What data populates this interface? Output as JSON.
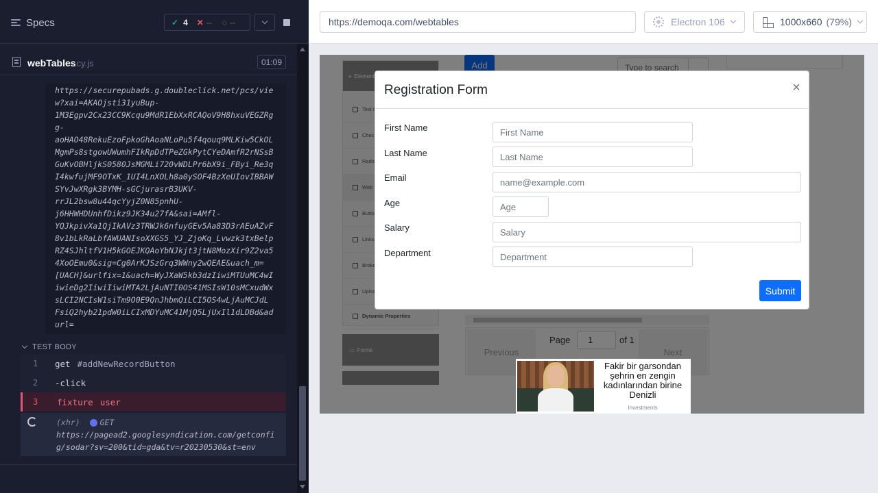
{
  "runner": {
    "specs_label": "Specs",
    "stats": {
      "passed": "4",
      "failed": "--",
      "pending": "--"
    },
    "spec": {
      "name": "webTables",
      "ext": ".cy.js",
      "duration": "01:09"
    },
    "log_url": "https://securepubads.g.doubleclick.net/pcs/view?xai=AKAOjsti31yuBup-1M3Egpv2Cx23CC9Kcqu9MdR1EbXxRCAQoV9H8hxuVEGZRgg-aoHAO48RekuEzoFpkoGhAoaNLoPu5f4qouq9MLKiw5CkOLMgmPs8stgowUWumhFIkRpDdTPeZGkPytCYeDAmfR2rNSsBGuKvOBHljkS0580JsMGMLi720vWDLPr6bX9i_FByi_Re3qI4kwfujMF9OTxK_1UI4LnXOLh8a0ySOF4BzXeUIovIBBAWSYvJwXRgk3BYMH-sGCjurasrB3UKV-rrJL2bsw8u44qcYyjZ0N85pnhU-j6HHWHDUnhfDikz9JK34u27fA&sai=AMfl-YQJkpivXa1QjIkAVz3TRWJk6nfuyGEv5Aa83D3rAEuAZvF8v1bLkRaLbfAWUANIsoXXGS5_YJ_ZjoKq_Lvwzk3txBelpRZ4SJhltfV1H5kGOEJKQAoYbNJkjt3jtN8MozXir9Z2va54XoOEmu0&sig=Cg0ArKJSzGrq3WWny2wQEAE&uach_m=[UACH]&urlfix=1&uach=WyJXaW5kb3dzIiwiMTUuMC4wIiwieDg2IiwiIiwiMTA2LjAuNTI0OS41MSIsW10sMCxudWxsLCI2NCIsW1siTm9O0E9QnJhbmQiLCI5OS4wLjAuMCJdLFsiQ2hyb21pdW0iLCIxMDYuMC41MjQ5LjUxIl1dLDBd&adurl=",
    "log_lines": [
      "https://securepubads.g.doubleclick.net/pcs/vie",
      "w?xai=AKAOjsti31yuBup-",
      "1M3Egpv2Cx23CC9Kcqu9MdR1EbXxRCAQoV9H8hxuVEGZRg",
      "g-",
      "aoHAO48RekuEzoFpkoGhAoaNLoPu5f4qouq9MLKiw5CkOL",
      "MgmPs8stgowUWumhFIkRpDdTPeZGkPytCYeDAmfR2rNSsB",
      "GuKvOBHljkS0580JsMGMLi720vWDLPr6bX9i_FByi_Re3q",
      "I4kwfujMF9OTxK_1UI4LnXOLh8a0ySOF4BzXeUIovIBBAW",
      "SYvJwXRgk3BYMH-sGCjurasrB3UKV-",
      "rrJL2bsw8u44qcYyjZ0N85pnhU-",
      "j6HHWHDUnhfDikz9JK34u27fA&sai=AMfl-",
      "YQJkpivXa1QjIkAVz3TRWJk6nfuyGEv5Aa83D3rAEuAZvF",
      "8v1bLkRaLbfAWUANIsoXXGS5_YJ_ZjoKq_Lvwzk3txBelp",
      "RZ4SJhltfV1H5kGOEJKQAoYbNJkjt3jtN8MozXir9Z2va5",
      "4XoOEmu0&sig=Cg0ArKJSzGrq3WWny2wQEAE&uach_m=",
      "[UACH]&urlfix=1&uach=WyJXaW5kb3dzIiwiMTUuMC4wI",
      "iwieDg2IiwiIiwiMTA2LjAuNTI0OS41MSIsW10sMCxudWx",
      "sLCI2NCIsW1siTm9O0E9QnJhbmQiLCI5OS4wLjAuMCJdL",
      "FsiQ2hyb21pdW0iLCIxMDYuMC41MjQ5LjUxIl1dLDBd&ad",
      "url="
    ],
    "test_body_label": "TEST BODY",
    "commands": [
      {
        "num": "1",
        "name": "get",
        "msg": "#addNewRecordButton"
      },
      {
        "num": "2",
        "name": "-click",
        "msg": ""
      },
      {
        "num": "3",
        "name": "fixture",
        "msg": "user"
      }
    ],
    "xhr": {
      "tag": "(xhr)",
      "method": "GET",
      "url_line1": "https://pagead2.googlesyndication.com/getconfi",
      "url_line2": "g/sodar?sv=200&tid=gda&tv=r20230530&st=env"
    }
  },
  "browser": {
    "url": "https://demoqa.com/webtables",
    "browser_name": "Electron 106",
    "viewport": "1000x660",
    "viewport_pct": "(79%)"
  },
  "aut": {
    "sidebar": {
      "group": "Elements",
      "items": [
        "Text Box",
        "Check Box",
        "Radio Button",
        "Web Tables",
        "Buttons",
        "Links",
        "Broken Links",
        "Upload and Download",
        "Dynamic Properties"
      ],
      "forms_group": "Forms"
    },
    "add_button": "Add",
    "search_placeholder": "Type to search",
    "pagination": {
      "previous": "Previous",
      "next": "Next",
      "page_label": "Page",
      "page_value": "1",
      "of_label": "of 1"
    },
    "modal": {
      "title": "Registration Form",
      "close": "×",
      "fields": [
        {
          "label": "First Name",
          "placeholder": "First Name"
        },
        {
          "label": "Last Name",
          "placeholder": "Last Name"
        },
        {
          "label": "Email",
          "placeholder": "name@example.com"
        },
        {
          "label": "Age",
          "placeholder": "Age"
        },
        {
          "label": "Salary",
          "placeholder": "Salary"
        },
        {
          "label": "Department",
          "placeholder": "Department"
        }
      ],
      "submit": "Submit"
    },
    "ad": {
      "headline": "Fakir bir garsondan şehrin en zengin kadınlarından birine Denizli",
      "source": "Investments"
    }
  }
}
